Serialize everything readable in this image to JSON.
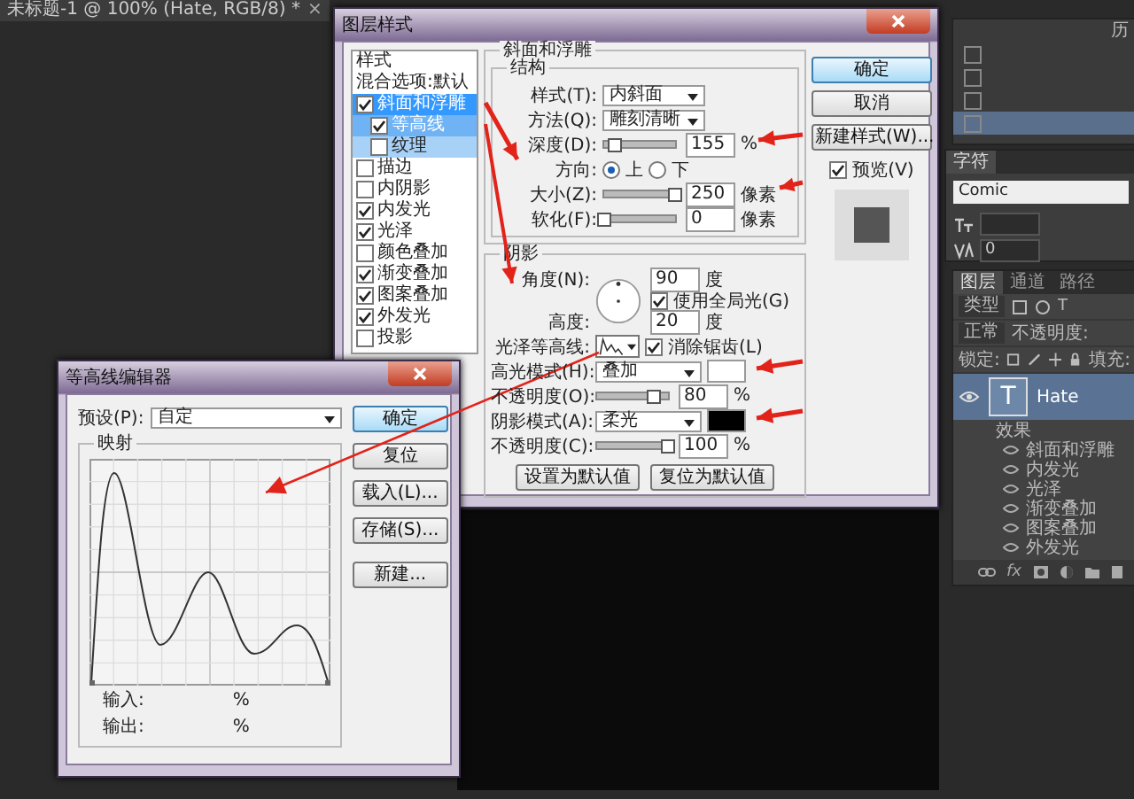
{
  "document_tab": {
    "title": "未标题-1 @ 100% (Hate, RGB/8) *",
    "close": "×"
  },
  "layer_style": {
    "title": "图层样式",
    "styles_header": "样式",
    "blending_options": "混合选项:默认",
    "styles": [
      {
        "label": "斜面和浮雕",
        "checked": true,
        "selected": true,
        "children": [
          {
            "label": "等高线",
            "checked": true,
            "selected": true
          },
          {
            "label": "纹理",
            "checked": false,
            "selected": false
          }
        ]
      },
      {
        "label": "描边",
        "checked": false,
        "selected": false
      },
      {
        "label": "内阴影",
        "checked": false,
        "selected": false
      },
      {
        "label": "内发光",
        "checked": true,
        "selected": false
      },
      {
        "label": "光泽",
        "checked": true,
        "selected": false
      },
      {
        "label": "颜色叠加",
        "checked": false,
        "selected": false
      },
      {
        "label": "渐变叠加",
        "checked": true,
        "selected": false
      },
      {
        "label": "图案叠加",
        "checked": true,
        "selected": false
      },
      {
        "label": "外发光",
        "checked": true,
        "selected": false
      },
      {
        "label": "投影",
        "checked": false,
        "selected": false
      }
    ],
    "bevel": {
      "title": "斜面和浮雕",
      "structure_title": "结构",
      "rows": [
        {
          "kind": "select",
          "label": "样式(T):",
          "value": "内斜面"
        },
        {
          "kind": "select",
          "label": "方法(Q):",
          "value": "雕刻清晰"
        },
        {
          "kind": "slider",
          "label": "深度(D):",
          "level": 0.15,
          "value": "155",
          "unit": "%"
        },
        {
          "kind": "radio",
          "label": "方向:",
          "options": [
            {
              "label": "上",
              "selected": true
            },
            {
              "label": "下",
              "selected": false
            }
          ]
        },
        {
          "kind": "slider",
          "label": "大小(Z):",
          "level": 1,
          "value": "250",
          "unit": "像素"
        },
        {
          "kind": "slider",
          "label": "软化(F):",
          "level": 0,
          "value": "0",
          "unit": "像素"
        }
      ]
    },
    "shading": {
      "title": "阴影",
      "angle": {
        "label": "角度(N):",
        "value": "90",
        "unit": "度"
      },
      "global_light": {
        "label": "使用全局光(G)",
        "checked": true
      },
      "altitude": {
        "label": "高度:",
        "value": "20",
        "unit": "度"
      },
      "gloss_contour_label": "光泽等高线:",
      "anti_aliased": {
        "label": "消除锯齿(L)",
        "checked": true
      },
      "rows": [
        {
          "kind": "blend",
          "label": "高光模式(H):",
          "value": "叠加",
          "color": "#ffffff"
        },
        {
          "kind": "slider",
          "label": "不透明度(O):",
          "level": 0.8,
          "value": "80",
          "unit": "%"
        },
        {
          "kind": "blend",
          "label": "阴影模式(A):",
          "value": "柔光",
          "color": "#000000"
        },
        {
          "kind": "slider",
          "label": "不透明度(C):",
          "level": 1,
          "value": "100",
          "unit": "%"
        }
      ]
    },
    "default_buttons": [
      "设置为默认值",
      "复位为默认值"
    ],
    "side_buttons": [
      {
        "label": "确定",
        "default": true
      },
      {
        "label": "取消",
        "default": false
      },
      {
        "label": "新建样式(W)...",
        "default": false
      }
    ],
    "preview": {
      "label": "预览(V)",
      "checked": true
    }
  },
  "contour_editor": {
    "title": "等高线编辑器",
    "preset_label": "预设(P):",
    "preset_value": "自定",
    "mapping_title": "映射",
    "input_label": "输入:",
    "input_unit": "%",
    "output_label": "输出:",
    "output_unit": "%",
    "buttons": [
      {
        "label": "确定",
        "default": true
      },
      {
        "label": "复位",
        "default": false
      },
      {
        "label": "载入(L)...",
        "default": false
      },
      {
        "label": "存储(S)...",
        "default": false
      },
      {
        "label": "新建...",
        "default": false
      }
    ]
  },
  "history_panel": {
    "tab": "历"
  },
  "character_panel": {
    "tab": "字符",
    "font": "Comic",
    "tracking": "0"
  },
  "layers_panel": {
    "tabs": [
      {
        "label": "图层",
        "selected": true
      },
      {
        "label": "通道",
        "selected": false
      },
      {
        "label": "路径",
        "selected": false
      }
    ],
    "filter": "类型",
    "filter_glyph": "T",
    "blend_mode": "正常",
    "opacity_label": "不透明度:",
    "lock_label": "锁定:",
    "fill_label": "填充:",
    "layer": {
      "name": "Hate",
      "thumbnail": "T",
      "selected": true
    },
    "effects_label": "效果",
    "effects": [
      "斜面和浮雕",
      "内发光",
      "光泽",
      "渐变叠加",
      "图案叠加",
      "外发光"
    ],
    "fx": "fx"
  }
}
